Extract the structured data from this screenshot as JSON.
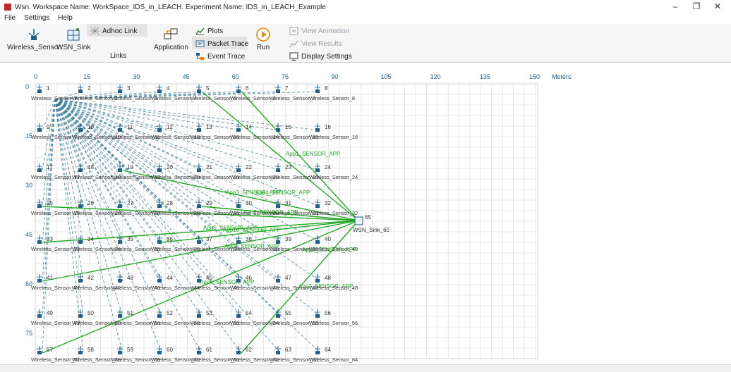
{
  "window": {
    "title": "Wsn. Workspace Name: WorkSpace_IDS_in_LEACH. Experiment Name: IDS_in_LEACH_Example",
    "minimize": "–",
    "restore": "❐",
    "close": "✕"
  },
  "menu": [
    "File",
    "Settings",
    "Help"
  ],
  "ribbon": {
    "wireless_sensor": "Wireless_Sensor",
    "wsn_sink": "WSN_Sink",
    "adhoc_link": "Adhoc Link",
    "links": "Links",
    "application": "Application",
    "plots": "Plots",
    "packet_trace": "Packet Trace",
    "event_trace": "Event Trace",
    "run": "Run",
    "view_animation": "View Animation",
    "view_results": "View Results",
    "display_settings": "Display Settings"
  },
  "grid": {
    "x_ticks": [
      "0",
      "15",
      "30",
      "45",
      "60",
      "75",
      "90",
      "105",
      "120",
      "135",
      "150"
    ],
    "y_ticks": [
      "0",
      "15",
      "30",
      "45",
      "60",
      "75"
    ],
    "x_unit": "Meters"
  },
  "sink": {
    "id": "65",
    "label": "WSN_Sink_65"
  },
  "app_labels": [
    "App1_SENSOR_APP",
    "App2_SENSOR_APP",
    "App3_SENSOR_APP",
    "App4_SENSOR_APP",
    "App5_SENSOR_APP",
    "App6_SENSOR_APP",
    "App7_SENSOR_APP",
    "App8_SENSOR_APP",
    "App9_SENSOR_APP",
    "App10_SENSOR_APP"
  ],
  "colors": {
    "grid": "#d6d6d6",
    "adhoc_link": "#3a7f9a",
    "app_flow": "#22aa22",
    "node": "#1f5f8b",
    "app_text": "#22aa22"
  }
}
